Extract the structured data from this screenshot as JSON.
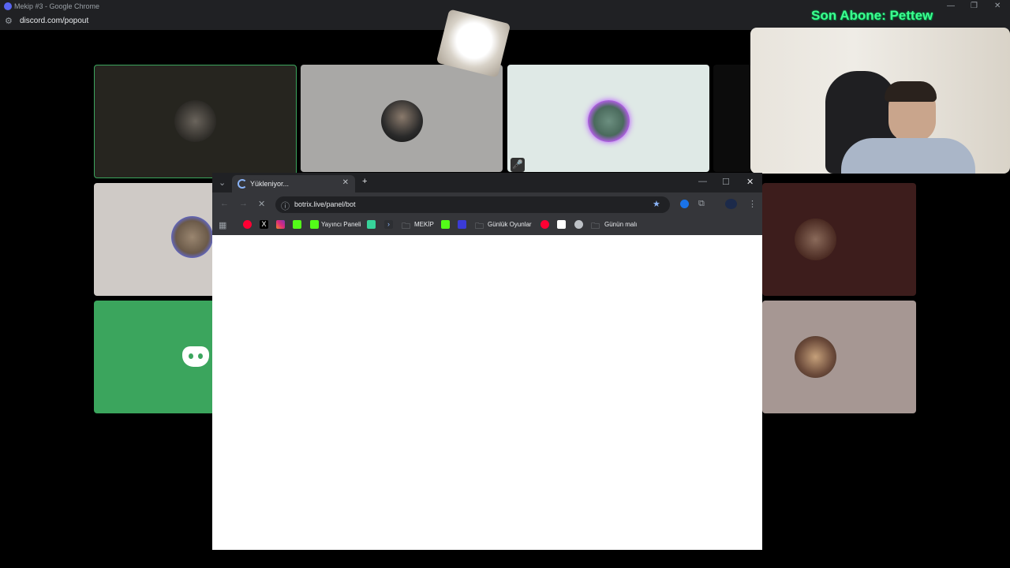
{
  "outer_window": {
    "title": "Mekip #3 - Google Chrome",
    "url": "discord.com/popout",
    "controls": [
      "—",
      "❐",
      "✕"
    ]
  },
  "overlay": {
    "son_abone": "Son Abone: Pettew"
  },
  "call": {
    "tiles": [
      {
        "id": "t1",
        "bg": "#26251f",
        "border": "#3ba55d"
      },
      {
        "id": "t2",
        "bg": "#a9a8a6"
      },
      {
        "id": "t3",
        "bg": "#dfe9e6"
      },
      {
        "id": "t4",
        "bg": "#cfcac6"
      },
      {
        "id": "t5",
        "bg": "#3d1d1c"
      },
      {
        "id": "t6",
        "bg": "#3ba55d"
      },
      {
        "id": "t7",
        "bg": "#a69793"
      }
    ]
  },
  "inner_window": {
    "tab_title": "Yükleniyor...",
    "url": "botrix.live/panel/bot",
    "bookmarks": [
      {
        "label": "Yayıncı Paneli",
        "icon": "kick-icon"
      },
      {
        "label": "MEKİP",
        "icon": "folder-icon"
      },
      {
        "label": "Günlük Oyunlar",
        "icon": "folder-icon"
      },
      {
        "label": "Günün malı",
        "icon": "folder-icon"
      }
    ],
    "colors": {
      "tabstrip": "#202124",
      "toolbar": "#35363a",
      "accent": "#8ab4f8"
    }
  }
}
